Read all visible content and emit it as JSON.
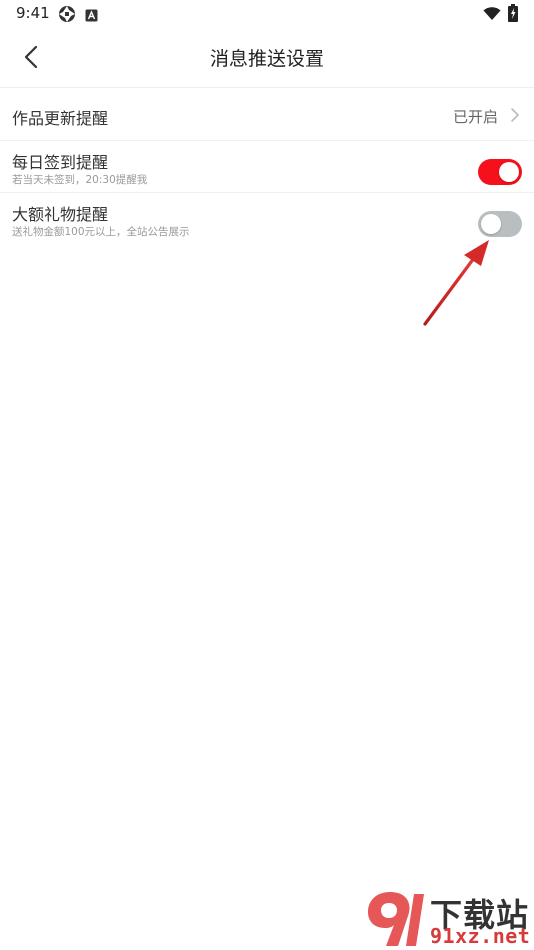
{
  "status_bar": {
    "time": "9:41",
    "icons": [
      "aperture-icon",
      "a-letter-badge-icon",
      "wifi-icon",
      "battery-charging-icon"
    ]
  },
  "header": {
    "title": "消息推送设置",
    "back_icon": "chevron-left-icon"
  },
  "settings": [
    {
      "title": "作品更新提醒",
      "value": "已开启",
      "control": "chevron-right-icon"
    },
    {
      "title": "每日签到提醒",
      "subtitle": "若当天未签到，20:30提醒我",
      "control": "toggle",
      "enabled": true
    },
    {
      "title": "大额礼物提醒",
      "subtitle": "送礼物金额100元以上，全站公告展示",
      "control": "toggle",
      "enabled": false
    }
  ],
  "annotation": {
    "icon": "red-arrow-icon",
    "color": "#d42a2a"
  },
  "watermark": {
    "line1": "下载站",
    "line2": "91xz.net",
    "logo": "91-logo-icon"
  },
  "colors": {
    "toggle_on": "#f5101c",
    "toggle_off": "#b9bec0",
    "text_primary": "#333333",
    "text_secondary": "#9a9a9a"
  }
}
